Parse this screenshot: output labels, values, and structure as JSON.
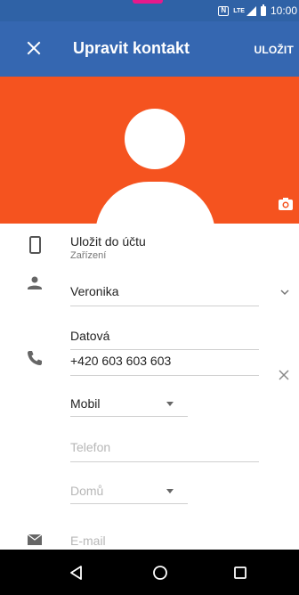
{
  "status_bar": {
    "nfc_label": "N",
    "network_label": "LTE",
    "time": "10:00"
  },
  "app_bar": {
    "close_icon": "close-icon",
    "title": "Upravit kontakt",
    "save_label": "ULOŽIT",
    "background_color": "#3567b1"
  },
  "header": {
    "background_color": "#f5531f",
    "avatar": "default-person-avatar",
    "camera_icon": "camera-icon"
  },
  "form": {
    "account": {
      "icon": "phone-device-icon",
      "label": "Uložit do účtu",
      "value": "Zařízení"
    },
    "name": {
      "icon": "person-icon",
      "first_name": "Veronika",
      "last_name": "Datová",
      "expand_icon": "chevron-down-icon"
    },
    "phone": {
      "icon": "phone-icon",
      "number": "+420 603 603 603",
      "type": "Mobil",
      "clear_icon": "close-icon"
    },
    "new_phone_placeholder": "Telefon",
    "new_phone_type": "Domů",
    "email_placeholder": "E-mail"
  },
  "nav_bar": {
    "back_icon": "back-triangle-icon",
    "home_icon": "home-circle-icon",
    "recents_icon": "recents-square-icon"
  }
}
